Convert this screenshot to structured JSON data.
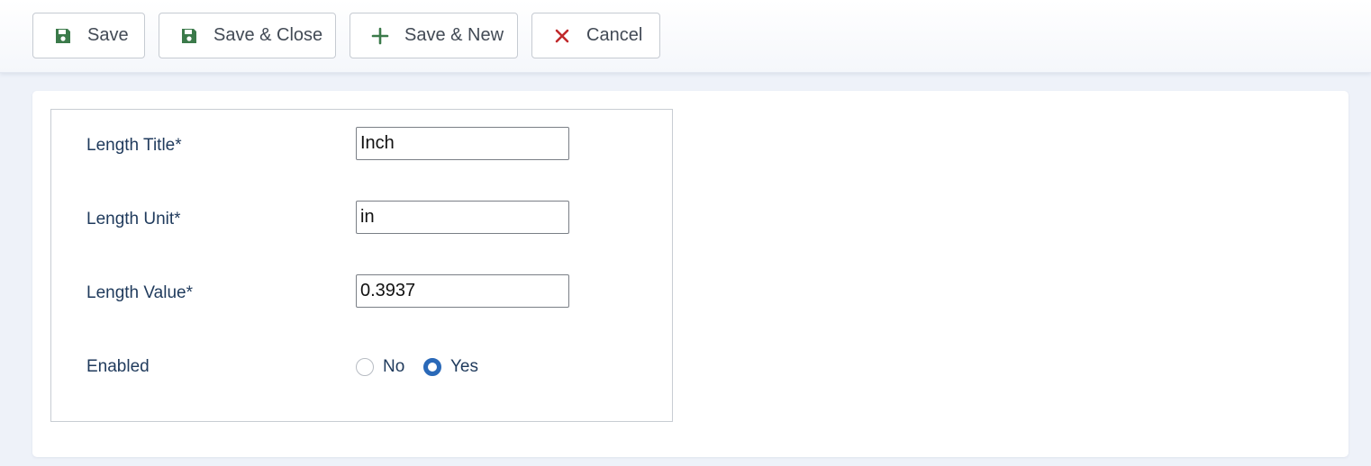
{
  "toolbar": {
    "save_label": "Save",
    "save_close_label": "Save & Close",
    "save_new_label": "Save & New",
    "cancel_label": "Cancel"
  },
  "form": {
    "title_label": "Length Title*",
    "title_value": "Inch",
    "unit_label": "Length Unit*",
    "unit_value": "in",
    "value_label": "Length Value*",
    "value_value": "0.3937",
    "enabled_label": "Enabled",
    "enabled_options": [
      "No",
      "Yes"
    ],
    "enabled_selected": "Yes"
  },
  "colors": {
    "save_icon": "#3b7a4a",
    "cancel_icon": "#c0292b",
    "radio_checked": "#2a69b8"
  },
  "icons": {
    "save": "floppy-disk-icon",
    "save_close": "floppy-disk-icon",
    "save_new": "plus-icon",
    "cancel": "x-icon"
  }
}
